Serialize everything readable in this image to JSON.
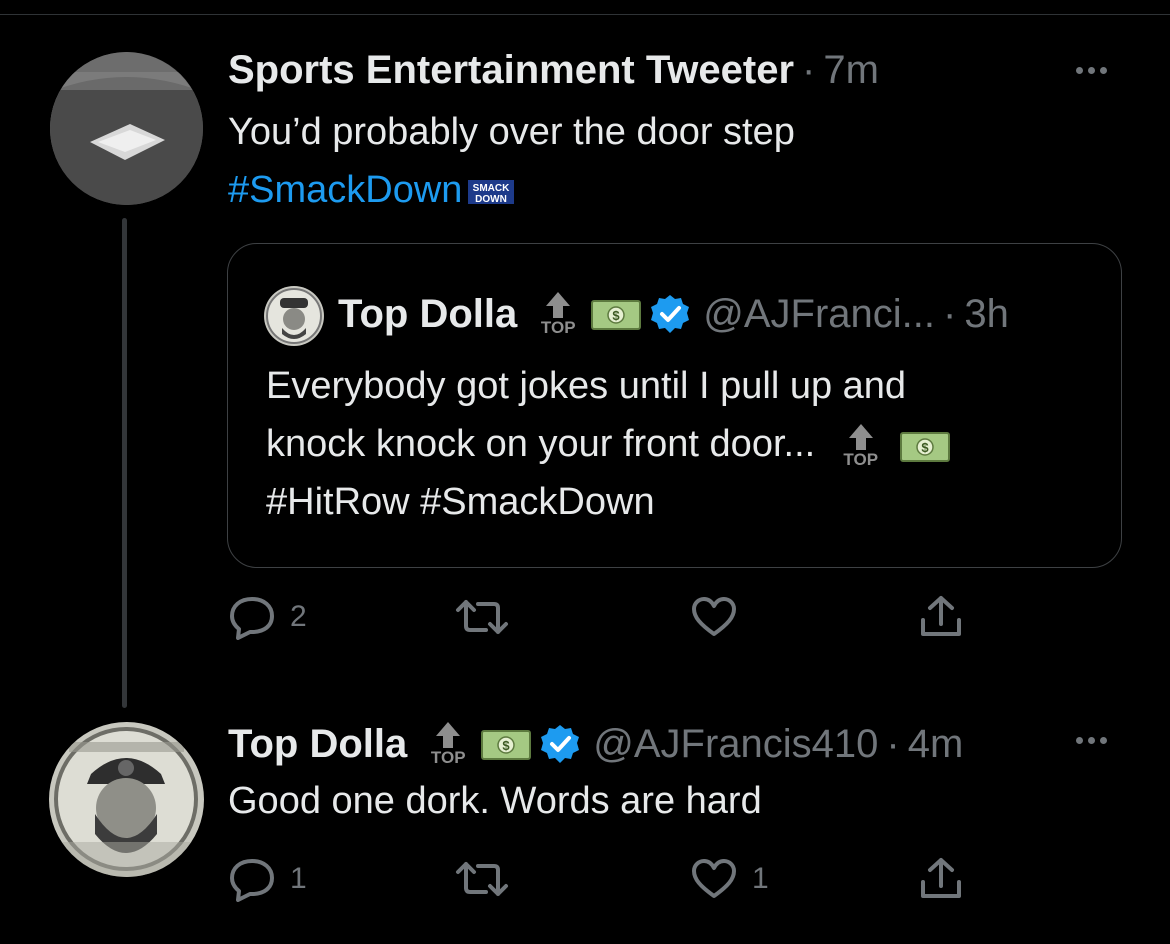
{
  "tweet1": {
    "author_name": "Sports Entertainment Tweeter",
    "separator": "·",
    "time": "7m",
    "text_line1": "You’d probably over the door step",
    "hashtag": "#SmackDown",
    "hashtag_emoji_label": "SMACK DOWN",
    "avatar_icon": "wrestling-ring-photo",
    "actions": {
      "reply_count": "2",
      "retweet_count": "",
      "like_count": ""
    }
  },
  "quoted": {
    "author_name": "Top Dolla",
    "handle": "@AJFranci...",
    "separator": "·",
    "time": "3h",
    "text_line1": "Everybody got jokes until I pull up and",
    "text_line2": "knock knock on your front door...",
    "text_line3": "#HitRow #SmackDown",
    "top_label": "TOP"
  },
  "tweet2": {
    "author_name": "Top Dolla",
    "handle": "@AJFrancis410",
    "separator": "·",
    "time": "4m",
    "text": "Good one dork. Words are hard",
    "top_label": "TOP",
    "actions": {
      "reply_count": "1",
      "retweet_count": "",
      "like_count": "1"
    }
  },
  "colors": {
    "background": "#000000",
    "text": "#e7e9ea",
    "muted": "#71767b",
    "link": "#1d9bf0",
    "verified": "#1d9bf0"
  }
}
